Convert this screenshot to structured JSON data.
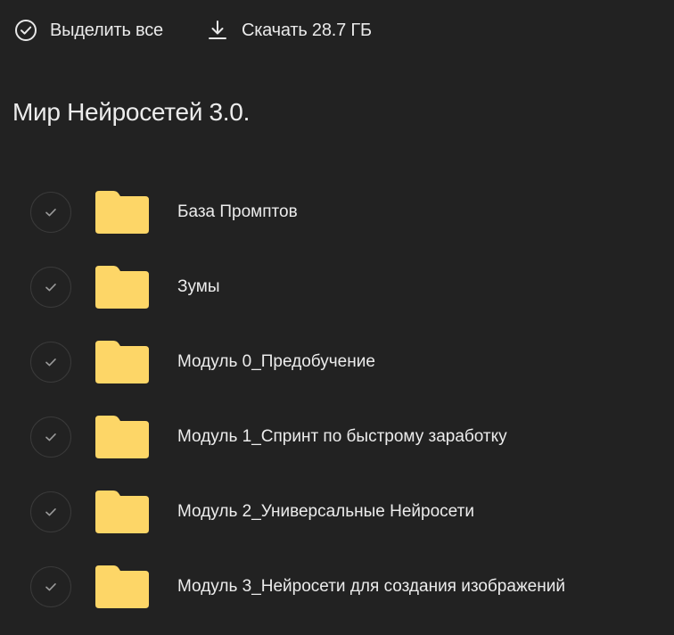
{
  "toolbar": {
    "select_all_label": "Выделить все",
    "download_label": "Скачать 28.7 ГБ"
  },
  "folder": {
    "title": "Мир Нейросетей 3.0."
  },
  "items": [
    {
      "label": "База Промптов",
      "icon": "folder-icon"
    },
    {
      "label": "Зумы",
      "icon": "folder-icon"
    },
    {
      "label": "Модуль 0_Предобучение",
      "icon": "folder-icon"
    },
    {
      "label": "Модуль 1_Спринт по быстрому заработку",
      "icon": "folder-icon"
    },
    {
      "label": "Модуль 2_Универсальные Нейросети",
      "icon": "folder-icon"
    },
    {
      "label": "Модуль 3_Нейросети для создания изображений",
      "icon": "folder-icon"
    }
  ],
  "colors": {
    "background": "#222222",
    "folder": "#FDD667",
    "text": "#ececec"
  }
}
